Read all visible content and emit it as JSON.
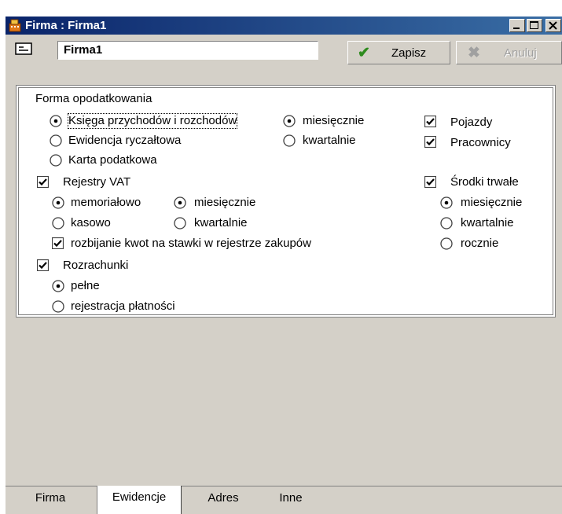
{
  "window": {
    "title": "Firma : Firma1"
  },
  "toolbar": {
    "record_name": "Firma1",
    "save_label": "Zapisz",
    "cancel_label": "Anuluj"
  },
  "section_tax": {
    "title": "Forma opodatkowania",
    "options": [
      {
        "label": "Księga przychodów i rozchodów",
        "selected": true
      },
      {
        "label": "Ewidencja ryczałtowa",
        "selected": false
      },
      {
        "label": "Karta podatkowa",
        "selected": false
      }
    ],
    "period": [
      {
        "label": "miesięcznie",
        "selected": true
      },
      {
        "label": "kwartalnie",
        "selected": false
      }
    ]
  },
  "right_checks": [
    {
      "label": "Pojazdy",
      "checked": true
    },
    {
      "label": "Pracownicy",
      "checked": true
    }
  ],
  "vat": {
    "label": "Rejestry VAT",
    "checked": true,
    "method": [
      {
        "label": "memoriałowo",
        "selected": true
      },
      {
        "label": "kasowo",
        "selected": false
      }
    ],
    "period": [
      {
        "label": "miesięcznie",
        "selected": true
      },
      {
        "label": "kwartalnie",
        "selected": false
      }
    ],
    "split": {
      "label": "rozbijanie kwot na stawki w rejestrze zakupów",
      "checked": true
    }
  },
  "fixed_assets": {
    "label": "Środki trwałe",
    "checked": true,
    "period": [
      {
        "label": "miesięcznie",
        "selected": true
      },
      {
        "label": "kwartalnie",
        "selected": false
      },
      {
        "label": "rocznie",
        "selected": false
      }
    ]
  },
  "settlements": {
    "label": "Rozrachunki",
    "checked": true,
    "options": [
      {
        "label": "pełne",
        "selected": true
      },
      {
        "label": "rejestracja płatności",
        "selected": false
      }
    ]
  },
  "tabs": [
    {
      "label": "Firma",
      "active": false
    },
    {
      "label": "Ewidencje",
      "active": true
    },
    {
      "label": "Adres",
      "active": false
    },
    {
      "label": "Inne",
      "active": false
    }
  ],
  "colors": {
    "title_start": "#0a246a",
    "title_end": "#3a6ea5",
    "save_check": "#2e8b1e",
    "face": "#d4d0c8"
  },
  "icons": {
    "app": "calculator-icon",
    "record": "record-card-icon",
    "save": "checkmark-icon",
    "cancel": "cross-icon"
  }
}
